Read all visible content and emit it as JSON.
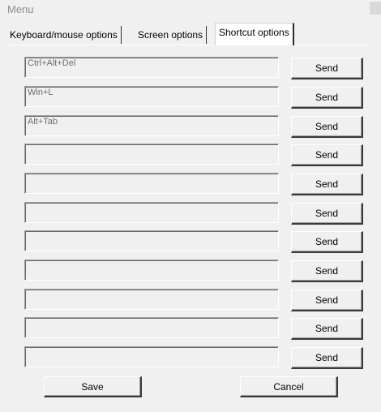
{
  "window": {
    "title": "Menu"
  },
  "tabs": [
    {
      "label": "Keyboard/mouse options",
      "active": false
    },
    {
      "label": "Screen options",
      "active": false
    },
    {
      "label": "Shortcut options",
      "active": true
    }
  ],
  "shortcuts": {
    "rows": [
      {
        "value": "Ctrl+Alt+Del",
        "send_label": "Send"
      },
      {
        "value": "Win+L",
        "send_label": "Send"
      },
      {
        "value": "Alt+Tab",
        "send_label": "Send"
      },
      {
        "value": "",
        "send_label": "Send"
      },
      {
        "value": "",
        "send_label": "Send"
      },
      {
        "value": "",
        "send_label": "Send"
      },
      {
        "value": "",
        "send_label": "Send"
      },
      {
        "value": "",
        "send_label": "Send"
      },
      {
        "value": "",
        "send_label": "Send"
      },
      {
        "value": "",
        "send_label": "Send"
      },
      {
        "value": "",
        "send_label": "Send"
      }
    ]
  },
  "footer": {
    "save_label": "Save",
    "cancel_label": "Cancel"
  }
}
